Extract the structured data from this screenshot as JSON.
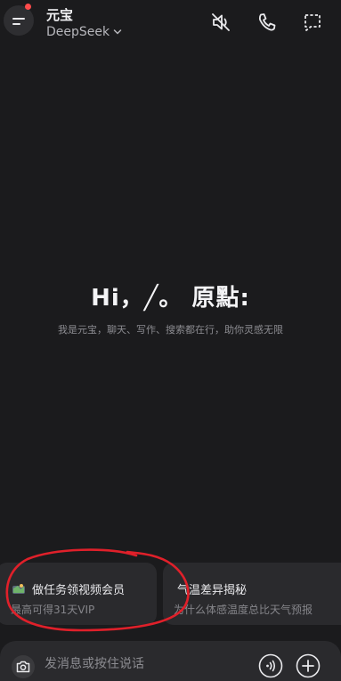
{
  "header": {
    "app_title": "元宝",
    "model_name": "DeepSeek"
  },
  "greeting": {
    "title": "Hi，╱。 原點:",
    "subtitle": "我是元宝，聊天、写作、搜索都在行，助你灵感无限"
  },
  "suggestions": [
    {
      "title": "做任务领视频会员",
      "subtitle": "最高可得31天VIP",
      "icon": "gift-icon"
    },
    {
      "title": "气温差异揭秘",
      "subtitle": "为什么体感温度总比天气预报"
    }
  ],
  "input": {
    "placeholder": "发消息或按住说话"
  },
  "colors": {
    "background": "#1b1b1d",
    "card": "#2a2a2d",
    "notification_dot": "#ff4b4b",
    "annotation": "#e0202a"
  }
}
